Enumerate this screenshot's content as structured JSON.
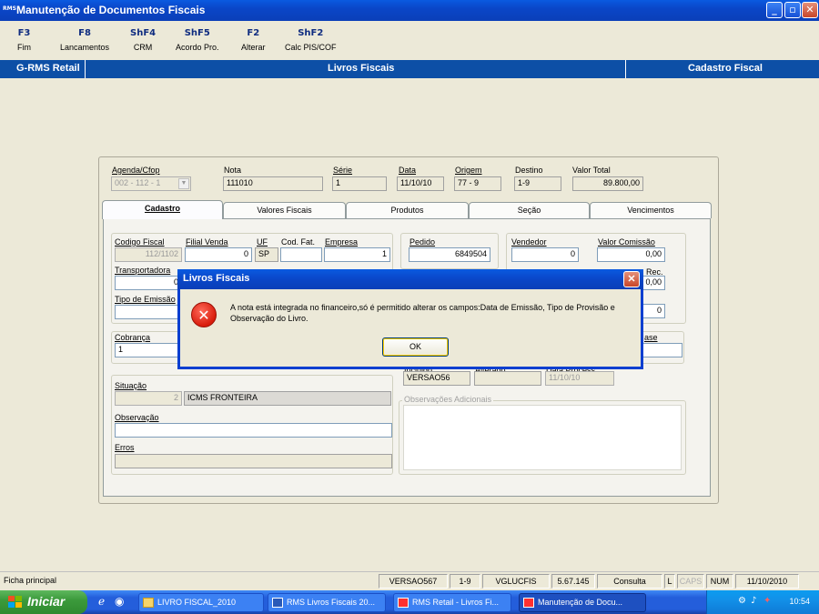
{
  "window": {
    "title": "Manutenção de Documentos Fiscais",
    "app_badge": "RMS"
  },
  "fkeys": [
    {
      "key": "F3",
      "label": "Fim"
    },
    {
      "key": "F8",
      "label": "Lancamentos"
    },
    {
      "key": "ShF4",
      "label": "CRM"
    },
    {
      "key": "ShF5",
      "label": "Acordo Pro."
    },
    {
      "key": "F2",
      "label": "Alterar"
    },
    {
      "key": "ShF2",
      "label": "Calc PIS/COF"
    }
  ],
  "band": {
    "left": "G-RMS Retail",
    "center": "Livros Fiscais",
    "right": "Cadastro Fiscal"
  },
  "header_fields": {
    "agenda_label": "Agenda/Cfop",
    "agenda_value": "002 - 112 - 1",
    "nota_label": "Nota",
    "nota_value": "111010",
    "serie_label": "Série",
    "serie_value": "1",
    "data_label": "Data",
    "data_value": "11/10/10",
    "origem_label": "Origem",
    "origem_value": "77 - 9",
    "destino_label": "Destino",
    "destino_value": "1-9",
    "valor_total_label": "Valor Total",
    "valor_total_value": "89.800,00"
  },
  "tabs": [
    {
      "label": "Cadastro",
      "active": true
    },
    {
      "label": "Valores Fiscais"
    },
    {
      "label": "Produtos"
    },
    {
      "label": "Seção"
    },
    {
      "label": "Vencimentos"
    }
  ],
  "cadastro": {
    "codigo_fiscal_label": "Codigo Fiscal",
    "codigo_fiscal_value": "112/1102",
    "filial_venda_label": "Filial Venda",
    "filial_venda_value": "0",
    "uf_label": "UF",
    "uf_value": "SP",
    "cod_fat_label": "Cod. Fat.",
    "empresa_label": "Empresa",
    "empresa_value": "1",
    "pedido_label": "Pedido",
    "pedido_value": "6849504",
    "vendedor_label": "Vendedor",
    "vendedor_value": "0",
    "valor_comissao_label": "Valor Comissão",
    "valor_comissao_value": "0,00",
    "transportadora_label": "Transportadora",
    "transportadora_value": "0",
    "rec_label": "Rec.",
    "rec_value": "0,00",
    "tipo_emissao_label": "Tipo de Emissão",
    "extra_value": "0",
    "cobranca_label": "Cobrança",
    "cobranca_value": "1",
    "base_label": "ase",
    "incluido_label": "Incluido",
    "incluido_value": "VERSAO56",
    "alterado_label": "Alterado",
    "data_process_label": "Data Process.",
    "data_process_value": "11/10/10",
    "situacao_label": "Situação",
    "situacao_code": "2",
    "situacao_desc": "ICMS FRONTEIRA",
    "observacao_label": "Observação",
    "erros_label": "Erros",
    "obs_adicionais_label": "Observações Adicionais"
  },
  "dialog": {
    "title": "Livros Fiscais",
    "message": "A nota está integrada no financeiro,só é permitido alterar os campos:Data de Emissão, Tipo de Provisão e Observação do Livro.",
    "ok_label": "OK"
  },
  "statusbar": {
    "left": "Ficha principal",
    "cells": [
      "VERSAO567",
      "1-9",
      "VGLUCFIS",
      "5.67.145",
      "Consulta",
      "L",
      "CAPS",
      "NUM",
      "11/10/2010"
    ]
  },
  "taskbar": {
    "start_label": "Iniciar",
    "tasks": [
      "LIVRO FISCAL_2010",
      "RMS Livros Fiscais 20...",
      "RMS Retail - Livros Fi...",
      "Manutenção de Docu..."
    ],
    "clock": "10:54"
  },
  "colors": {
    "titlebar": "#0a46c8",
    "band": "#0d4fa6",
    "error": "#d81c0c"
  }
}
